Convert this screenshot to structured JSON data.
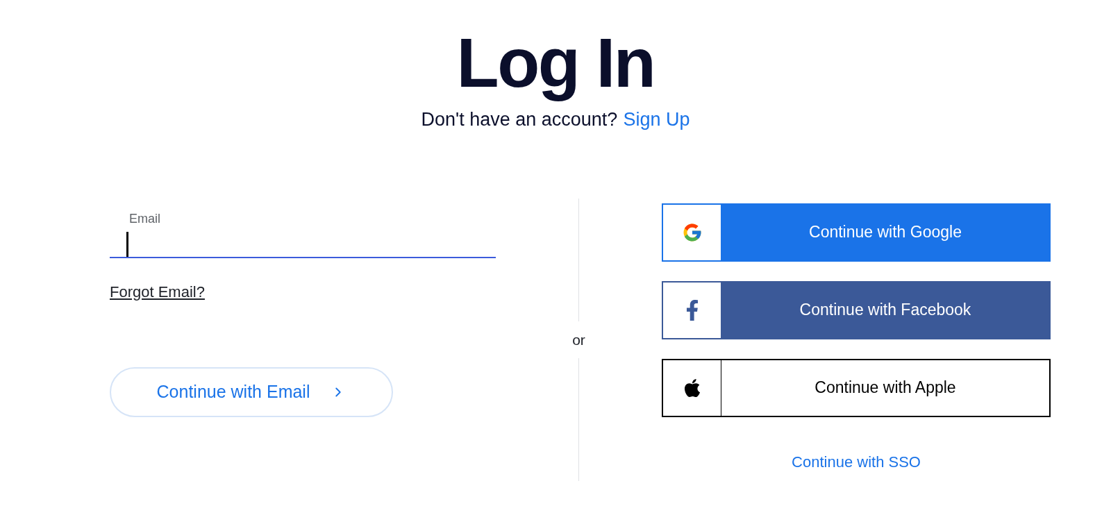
{
  "title": "Log In",
  "signup_prompt": {
    "text": "Don't have an account?",
    "link": "Sign Up"
  },
  "email_field": {
    "label": "Email",
    "focused": true
  },
  "forgot_link": "Forgot Email?",
  "email_button": "Continue with Email",
  "divider": "or",
  "social_buttons": [
    {
      "kind": "google",
      "label": "Continue with Google"
    },
    {
      "kind": "facebook",
      "label": "Continue with Facebook"
    },
    {
      "kind": "apple",
      "label": "Continue with Apple"
    }
  ],
  "sso_link": "Continue with SSO"
}
